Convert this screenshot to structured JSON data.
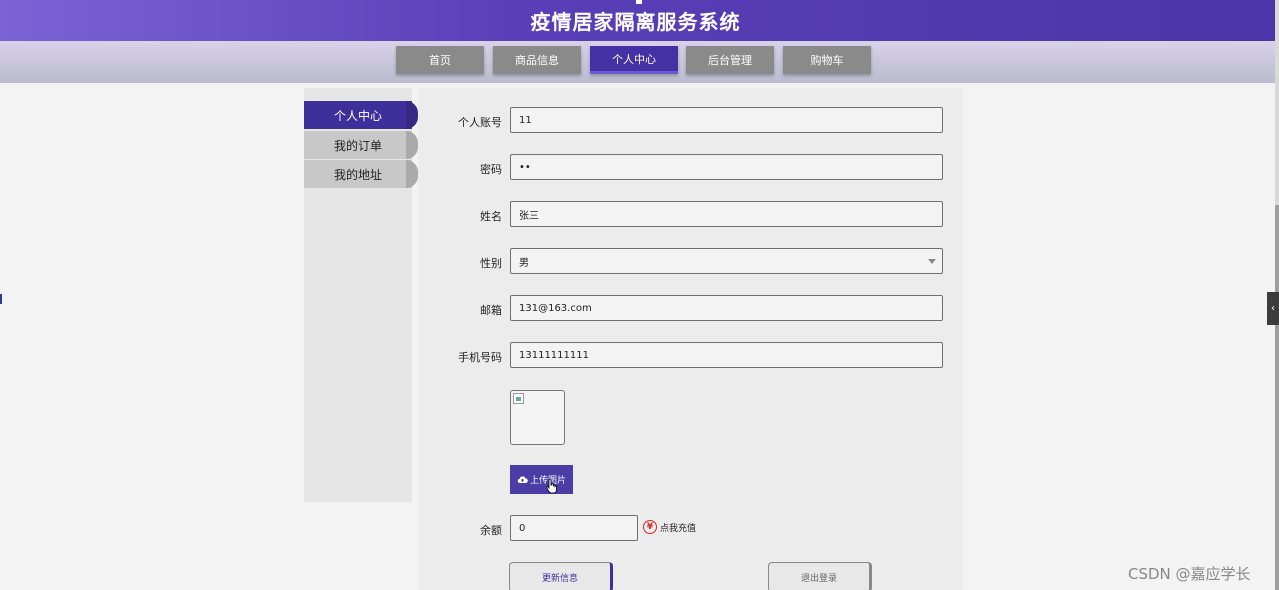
{
  "header": {
    "title": "疫情居家隔离服务系统"
  },
  "nav": {
    "tabs": [
      {
        "label": "首页",
        "active": false
      },
      {
        "label": "商品信息",
        "active": false
      },
      {
        "label": "个人中心",
        "active": true
      },
      {
        "label": "后台管理",
        "active": false
      },
      {
        "label": "购物车",
        "active": false
      }
    ]
  },
  "sidebar": {
    "items": [
      {
        "label": "个人中心",
        "active": true
      },
      {
        "label": "我的订单",
        "active": false
      },
      {
        "label": "我的地址",
        "active": false
      }
    ]
  },
  "form": {
    "account": {
      "label": "个人账号",
      "value": "11"
    },
    "password": {
      "label": "密码",
      "value": "••"
    },
    "name": {
      "label": "姓名",
      "value": "张三"
    },
    "gender": {
      "label": "性别",
      "value": "男"
    },
    "email": {
      "label": "邮箱",
      "value": "131@163.com"
    },
    "phone": {
      "label": "手机号码",
      "value": "13111111111"
    },
    "upload_label": "上传图片",
    "balance": {
      "label": "余额",
      "value": "0"
    },
    "recharge_label": "点我充值",
    "recharge_icon": "¥",
    "update_button": "更新信息",
    "logout_button": "退出登录"
  },
  "watermark": "CSDN @嘉应学长",
  "colors": {
    "primary": "#4431a3",
    "header_gradient_start": "#7b63d6",
    "accent_red": "#d42a2a"
  }
}
